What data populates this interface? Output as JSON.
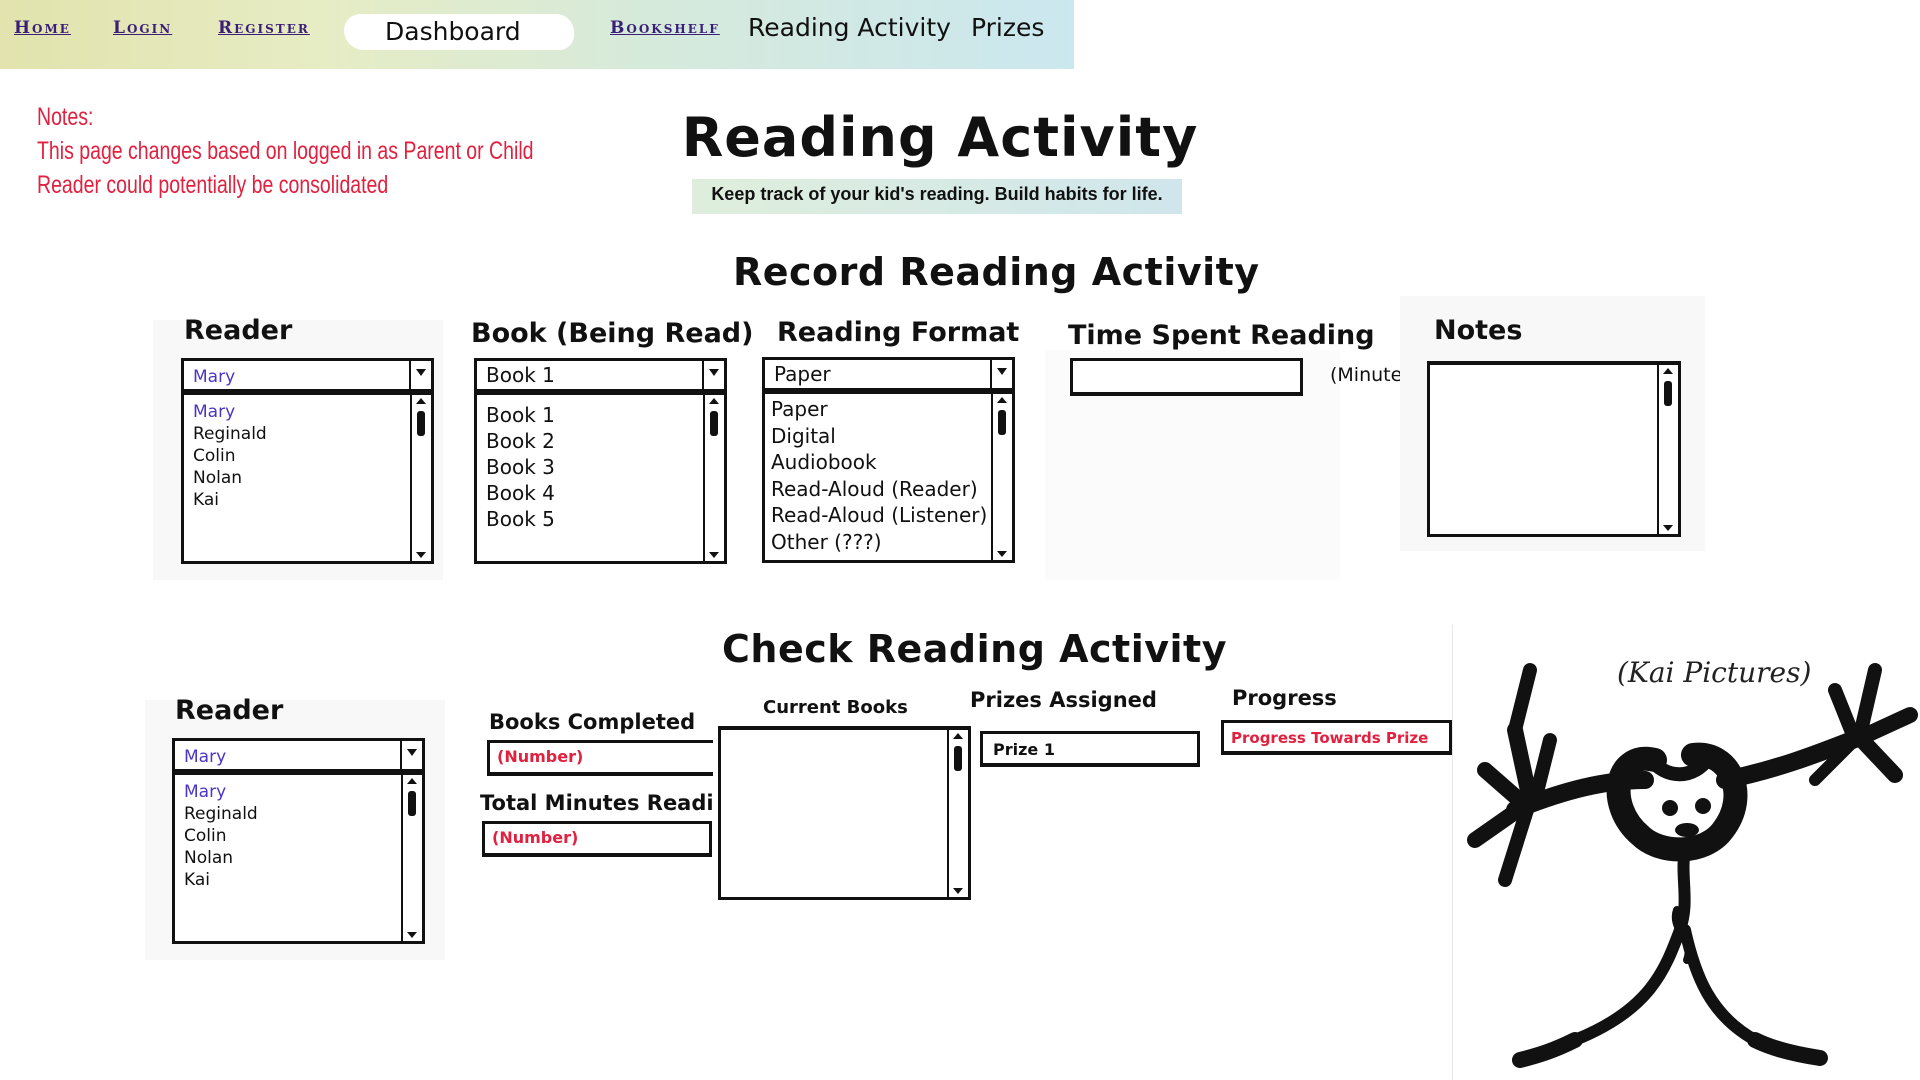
{
  "nav": {
    "home": "Home",
    "login": "Login",
    "register": "Register",
    "dashboard": "Dashboard",
    "bookshelf": "Bookshelf",
    "reading_activity": "Reading Activity",
    "prizes": "Prizes"
  },
  "notes": {
    "heading": "Notes:",
    "line1": "This page changes based on logged in as Parent or Child",
    "line2": "Reader could potentially be consolidated"
  },
  "page": {
    "title": "Reading Activity",
    "subtitle": "Keep track of your kid's reading. Build habits for life."
  },
  "record": {
    "title": "Record Reading Activity",
    "reader": {
      "label": "Reader",
      "selected": "Mary",
      "options": [
        "Mary",
        "Reginald",
        "Colin",
        "Nolan",
        "Kai"
      ]
    },
    "book": {
      "label": "Book (Being Read)",
      "selected": "Book 1",
      "options": [
        "Book 1",
        "Book 2",
        "Book 3",
        "Book 4",
        "Book 5"
      ]
    },
    "format": {
      "label": "Reading Format",
      "selected": "Paper",
      "options": [
        "Paper",
        "Digital",
        "Audiobook",
        "Read-Aloud (Reader)",
        "Read-Aloud (Listener)",
        "Other (???)"
      ]
    },
    "time": {
      "label": "Time Spent Reading",
      "value": "",
      "unit": "(Minutes)"
    },
    "notes": {
      "label": "Notes",
      "value": ""
    }
  },
  "check": {
    "title": "Check Reading Activity",
    "reader": {
      "label": "Reader",
      "selected": "Mary",
      "options": [
        "Mary",
        "Reginald",
        "Colin",
        "Nolan",
        "Kai"
      ]
    },
    "books_completed": {
      "label": "Books Completed",
      "value": "(Number)"
    },
    "total_minutes": {
      "label": "Total Minutes Readin",
      "value": "(Number)"
    },
    "current_books": {
      "label": "Current Books"
    },
    "prizes_assigned": {
      "label": "Prizes Assigned",
      "value": "Prize 1"
    },
    "progress": {
      "label": "Progress",
      "value": "Progress Towards Prize"
    }
  },
  "kai_pictures": {
    "label": "(Kai Pictures)"
  },
  "colors": {
    "accent_red": "#e0213f",
    "accent_purple": "#4a35c4",
    "nav_link": "#3b1e78"
  }
}
